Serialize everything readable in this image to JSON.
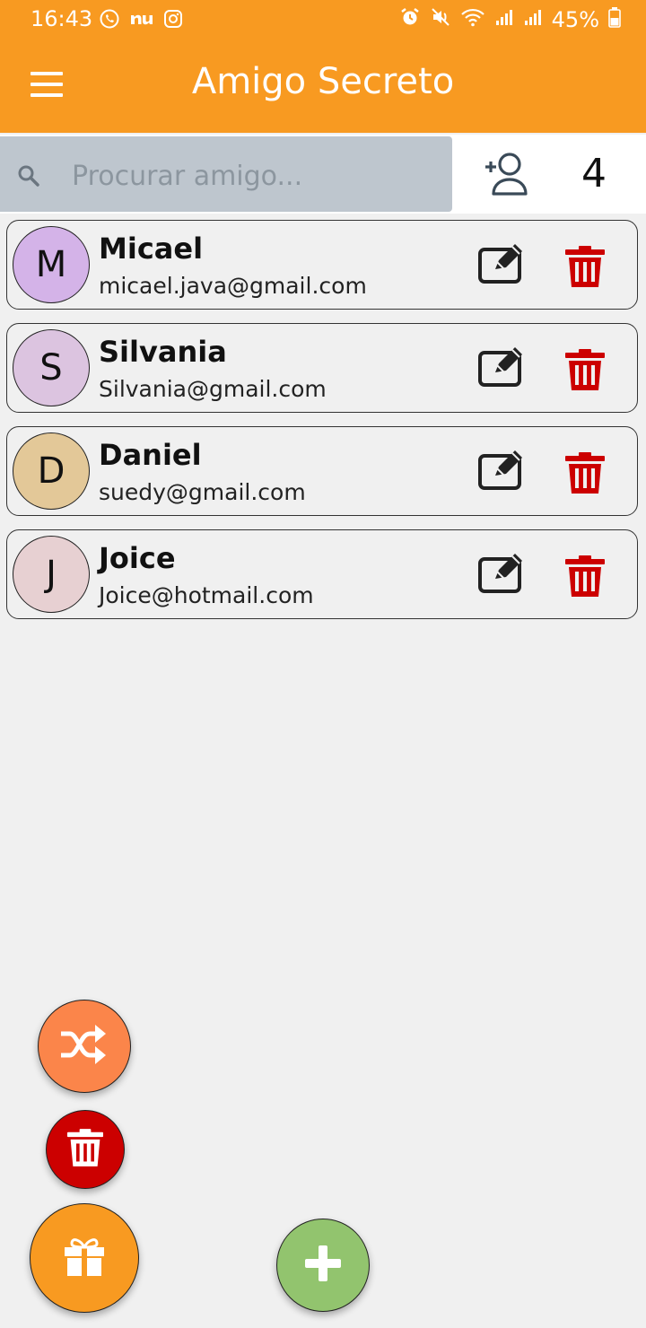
{
  "status_bar": {
    "time": "16:43",
    "left_icons": [
      "whatsapp-icon",
      "nu-icon",
      "instagram-icon"
    ],
    "right_icons": [
      "alarm-icon",
      "mute-icon",
      "wifi-icon",
      "signal-icon",
      "signal-icon"
    ],
    "battery": "45%"
  },
  "app_bar": {
    "title": "Amigo Secreto",
    "background": "#f89a21"
  },
  "search": {
    "placeholder": "Procurar amigo...",
    "value": ""
  },
  "friend_count": "4",
  "friends": [
    {
      "initial": "M",
      "name": "Micael",
      "email": "micael.java@gmail.com",
      "avatar_color": "#d4b3e8"
    },
    {
      "initial": "S",
      "name": "Silvania",
      "email": "Silvania@gmail.com",
      "avatar_color": "#dcc4e0"
    },
    {
      "initial": "D",
      "name": "Daniel",
      "email": "suedy@gmail.com",
      "avatar_color": "#e3c898"
    },
    {
      "initial": "J",
      "name": "Joice",
      "email": "Joice@hotmail.com",
      "avatar_color": "#e7d0d2"
    }
  ],
  "colors": {
    "accent": "#f89a21",
    "delete": "#cc0000",
    "shuffle": "#fb854a",
    "add": "#92c46e"
  }
}
